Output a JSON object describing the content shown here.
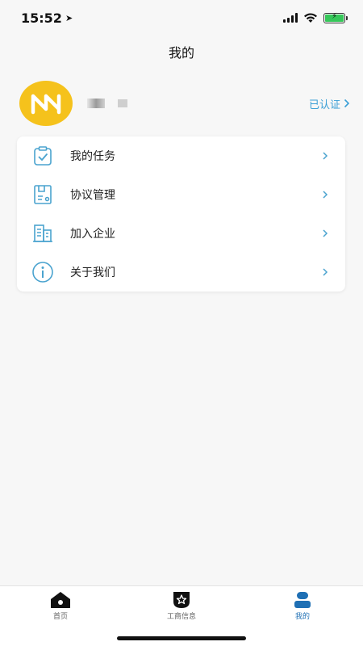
{
  "status_bar": {
    "time": "15:52",
    "location_icon": "location-arrow-icon",
    "signal_icon": "cellular-signal-icon",
    "wifi_icon": "wifi-icon",
    "battery_icon": "battery-charging-icon"
  },
  "header": {
    "title": "我的"
  },
  "profile": {
    "avatar_icon": "logo-avatar-icon",
    "verified_label": "已认证",
    "verified_icon": "chevron-right-icon"
  },
  "menu": {
    "items": [
      {
        "label": "我的任务",
        "icon": "clipboard-check-icon"
      },
      {
        "label": "协议管理",
        "icon": "document-icon"
      },
      {
        "label": "加入企业",
        "icon": "building-icon"
      },
      {
        "label": "关于我们",
        "icon": "info-icon"
      }
    ]
  },
  "tabbar": {
    "tabs": [
      {
        "label": "首页",
        "icon": "home-icon",
        "active": false
      },
      {
        "label": "工商信息",
        "icon": "badge-star-icon",
        "active": false
      },
      {
        "label": "我的",
        "icon": "user-icon",
        "active": true
      }
    ]
  },
  "colors": {
    "accent": "#3a9fd6",
    "tab_active": "#1e6fb4",
    "avatar_bg": "#f5c21c",
    "icon_blue": "#4aa3cf"
  }
}
